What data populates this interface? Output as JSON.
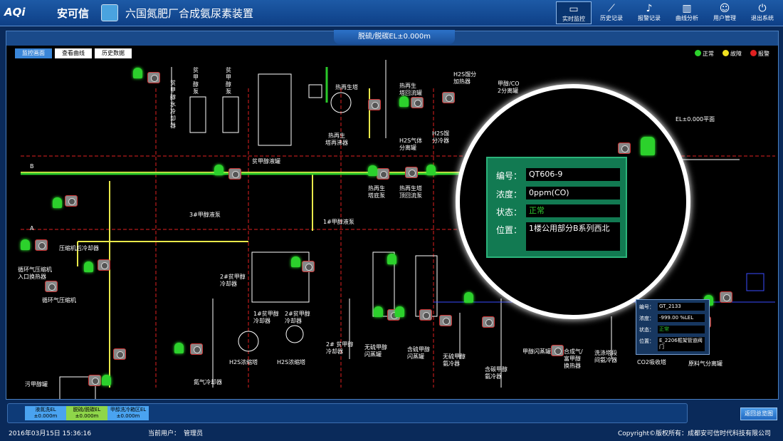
{
  "header": {
    "logo_text": "AQi",
    "logo_cn": "安可信",
    "title": "六国氮肥厂合成氨尿素装置"
  },
  "nav": [
    {
      "label": "实时监控",
      "icon": "monitor-icon",
      "active": true
    },
    {
      "label": "历史记录",
      "icon": "trend-icon",
      "active": false
    },
    {
      "label": "报警记录",
      "icon": "bell-icon",
      "active": false
    },
    {
      "label": "曲线分析",
      "icon": "chart-icon",
      "active": false
    },
    {
      "label": "用户管理",
      "icon": "user-icon",
      "active": false
    },
    {
      "label": "退出系统",
      "icon": "power-icon",
      "active": false
    }
  ],
  "frame": {
    "title": "脱硫/脱碳EL±0.000m"
  },
  "tabs": [
    "监控画面",
    "查看曲线",
    "历史数据"
  ],
  "legend": [
    {
      "label": "正常",
      "color": "#2cd12c"
    },
    {
      "label": "故障",
      "color": "#f0e020"
    },
    {
      "label": "报警",
      "color": "#e02020"
    }
  ],
  "labels": {
    "el_plane": "EL±0.000平面",
    "axis_b": "B",
    "axis_a": "A",
    "pinkjia_v1": "贫甲醇水冷却器",
    "pinkjia_v2": "贫甲醇泵",
    "pinkjia_v3": "贫甲醇泵",
    "pinkjia_tank": "贫甲醇液罐",
    "reheat_tower": "热再生塔",
    "reheat_boiler1": "热再生",
    "reheat_boiler2": "塔再沸器",
    "reheat_reflux1": "热再生",
    "reheat_reflux2": "塔回流罐",
    "h2s_gas1": "H2S气体",
    "h2s_gas2": "分离罐",
    "h2s_cool1": "H2S馏",
    "h2s_cool2": "分冷器",
    "h2s_heat1": "H2S馏分",
    "h2s_heat2": "加热器",
    "meth_co1": "甲醇/CO",
    "meth_co2": "2分离罐",
    "bottom_pump1": "热再生",
    "bottom_pump2": "塔底泵",
    "top_pump1": "热再生塔",
    "top_pump2": "顶回流泵",
    "pump3": "3#甲醇液泵",
    "pump1": "1#甲醇液泵",
    "compressor_cooler": "压缩机后冷却器",
    "cycle_comp1": "循环气压缩机",
    "cycle_comp2": "入口换热器",
    "cycle_comp": "循环气压缩机",
    "cooler2_1": "2#贫甲醇",
    "cooler2_2": "冷却器",
    "cooler1a_1": "1#贫甲醇",
    "cooler1a_2": "冷却器",
    "cooler2b_1": "2#贫甲醇",
    "cooler2b_2": "冷却器",
    "cooler2c_1": "2# 贫甲醇",
    "cooler2c_2": "冷却器",
    "h2s_conc1": "H2S浓缩塔",
    "h2s_conc2": "H2S浓缩塔",
    "n2_cooler": "氮气冷却器",
    "sulfur_free1": "无硫甲醇",
    "sulfur_free2": "闪蒸罐",
    "sulfur_meth1": "含硫甲醇",
    "sulfur_meth2": "闪蒸罐",
    "nosulfur_ammo1": "无硫甲醇",
    "nosulfur_ammo2": "氨冷器",
    "carbon_meth1": "含碳甲醇",
    "carbon_meth2": "氨冷器",
    "meth_flash": "甲醇闪蒸罐",
    "syn_gas1": "合成气/",
    "syn_gas2": "富甲醇",
    "syn_gas3": "换热器",
    "wash_tower1": "洗涤塔段",
    "wash_tower2": "间氨冷器",
    "co2_absorb": "CO2吸收塔",
    "raw_gas": "原料气分离罐",
    "waste_tank": "污甲醇罐"
  },
  "detail": {
    "id_label": "编号：",
    "id_value": "QT606-9",
    "conc_label": "浓度：",
    "conc_value": "0ppm(CO)",
    "state_label": "状态：",
    "state_value": "正常",
    "loc_label": "位置：",
    "loc_value": "1楼公用部分B系列西北"
  },
  "mini_panel": {
    "id_label": "编号：",
    "id_value": "GT_2133",
    "conc_label": "浓度：",
    "conc_value": "-999.00 %LEL",
    "state_label": "状态：",
    "state_value": "正常",
    "loc_label": "位置：",
    "loc_value": "E_2206框架管道阀门"
  },
  "bottom_buttons": [
    {
      "label": "液氮洗EL",
      "sub": "±0.000m",
      "color": "#4aa3f0"
    },
    {
      "label": "脱硫/脱碳EL",
      "sub": "±0.000m",
      "color": "#8fd64a"
    },
    {
      "label": "甲醇洗冷箱区EL",
      "sub": "±0.000m",
      "color": "#4aa3f0"
    }
  ],
  "back_button": "返回总览图",
  "status": {
    "datetime": "2016年03月15日  15:36:16",
    "user_label": "当前用户：",
    "user": "管理员",
    "copyright": "Copyright©版权所有：成都安可信时代科技有限公司"
  }
}
